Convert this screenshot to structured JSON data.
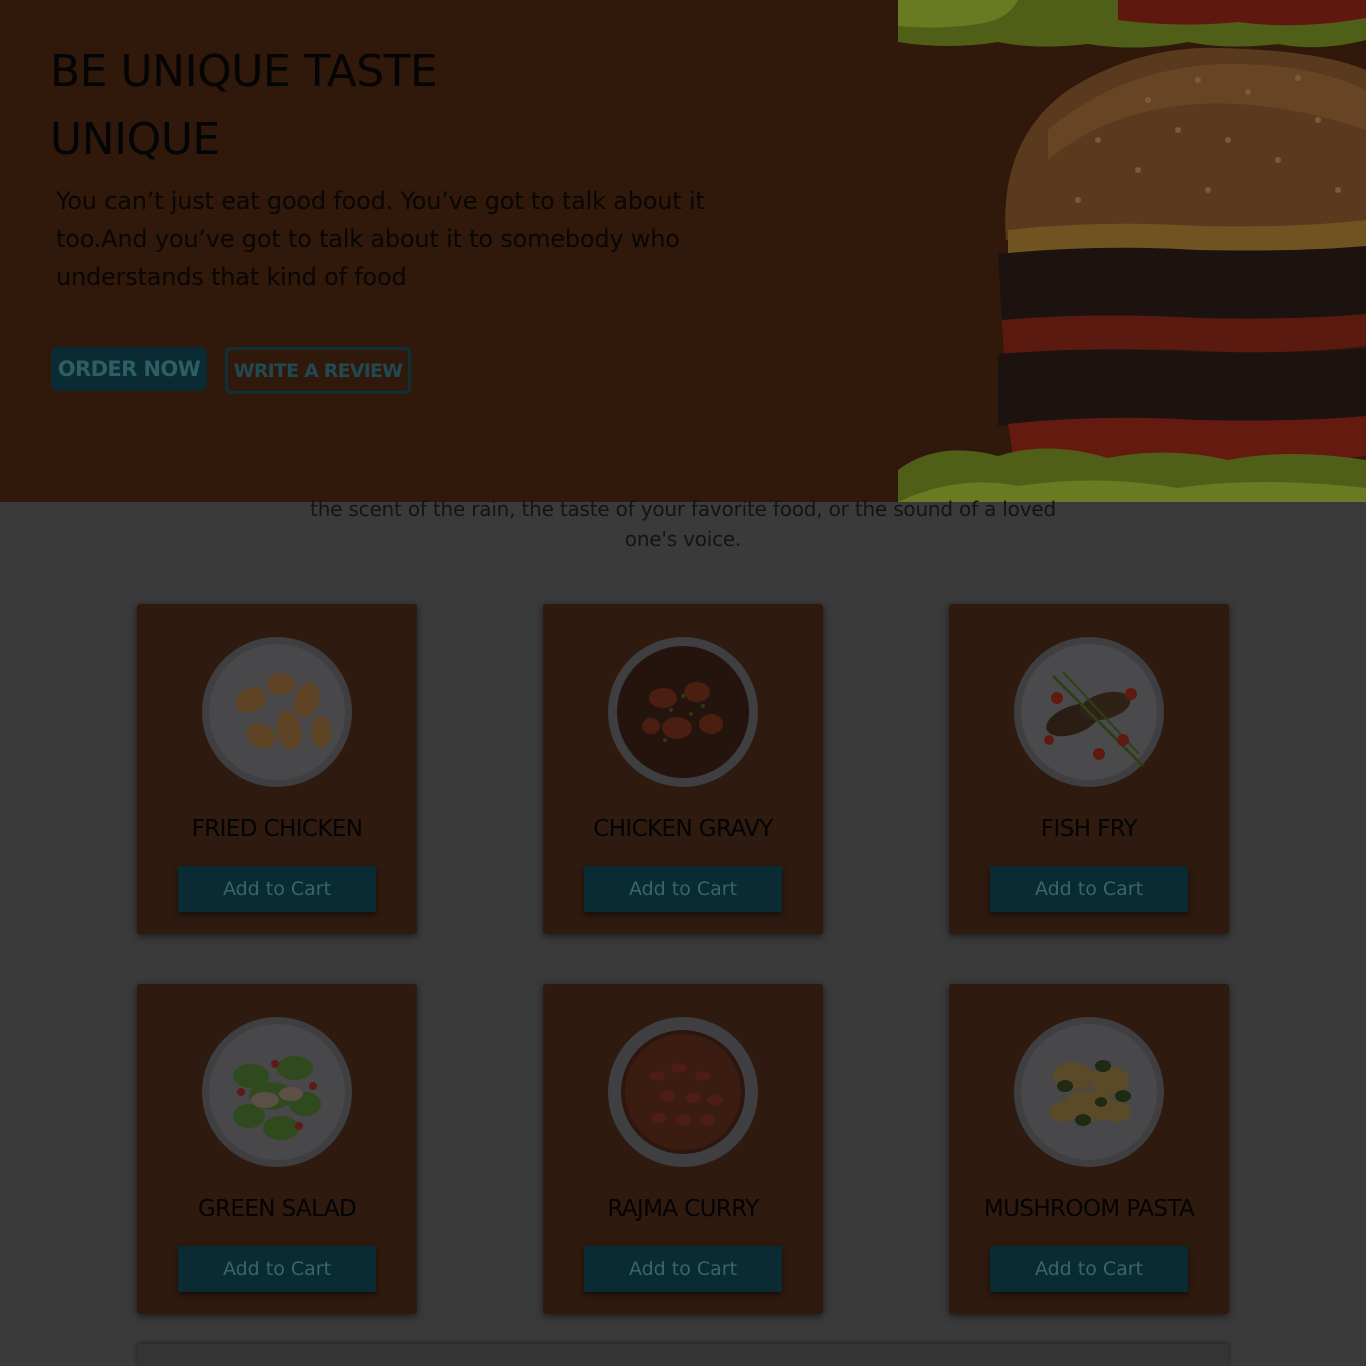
{
  "hero": {
    "title_line1": "BE UNIQUE TASTE",
    "title_line2": "UNIQUE",
    "text": "You can’t just eat good food. You’ve got to talk about it too.And you’ve got to talk about it to somebody who understands that kind of food",
    "order_label": "ORDER NOW",
    "review_label": "WRITE A REVIEW",
    "image": "burger"
  },
  "subtext": "the scent of the rain, the taste of your favorite food, or the sound of a loved one's voice.",
  "menu": [
    {
      "name": "FRIED CHICKEN",
      "button": "Add to Cart",
      "image": "fried-chicken"
    },
    {
      "name": "CHICKEN GRAVY",
      "button": "Add to Cart",
      "image": "chicken-gravy"
    },
    {
      "name": "FISH FRY",
      "button": "Add to Cart",
      "image": "fish-fry"
    },
    {
      "name": "GREEN SALAD",
      "button": "Add to Cart",
      "image": "green-salad"
    },
    {
      "name": "RAJMA CURRY",
      "button": "Add to Cart",
      "image": "rajma-curry"
    },
    {
      "name": "MUSHROOM PASTA",
      "button": "Add to Cart",
      "image": "mushroom-pasta"
    }
  ],
  "colors": {
    "hero_bg": "#30180b",
    "page_bg": "#3a3a3a",
    "card_bg": "#2e1a0f",
    "button_bg": "#0a2b33",
    "button_text": "#38666c"
  }
}
